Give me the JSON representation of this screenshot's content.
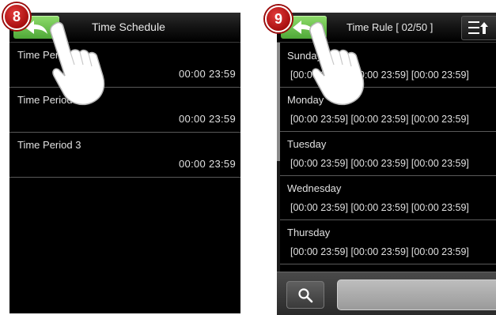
{
  "steps": {
    "left": "8",
    "right": "9"
  },
  "left_screen": {
    "title": "Time Schedule",
    "periods": [
      {
        "name": "Time Period 1",
        "time": "00:00  23:59"
      },
      {
        "name": "Time Period 2",
        "time": "00:00  23:59"
      },
      {
        "name": "Time Period 3",
        "time": "00:00  23:59"
      }
    ]
  },
  "right_screen": {
    "title": "Time Rule [ 02/50 ]",
    "days": [
      {
        "name": "Sunday",
        "ranges": "[00:00 23:59] [00:00 23:59] [00:00 23:59]"
      },
      {
        "name": "Monday",
        "ranges": "[00:00 23:59] [00:00 23:59] [00:00 23:59]"
      },
      {
        "name": "Tuesday",
        "ranges": "[00:00 23:59] [00:00 23:59] [00:00 23:59]"
      },
      {
        "name": "Wednesday",
        "ranges": "[00:00 23:59] [00:00 23:59] [00:00 23:59]"
      },
      {
        "name": "Thursday",
        "ranges": "[00:00 23:59] [00:00 23:59] [00:00 23:59]"
      }
    ],
    "search": {
      "value": ""
    }
  },
  "colors": {
    "back_button": "#6cc24a",
    "step_badge": "#c41a1a",
    "screen_bg": "#000000"
  },
  "icons": {
    "back": "back-arrow-icon",
    "menu": "sort-menu-icon",
    "search": "search-icon",
    "pointer": "pointing-hand-icon"
  }
}
